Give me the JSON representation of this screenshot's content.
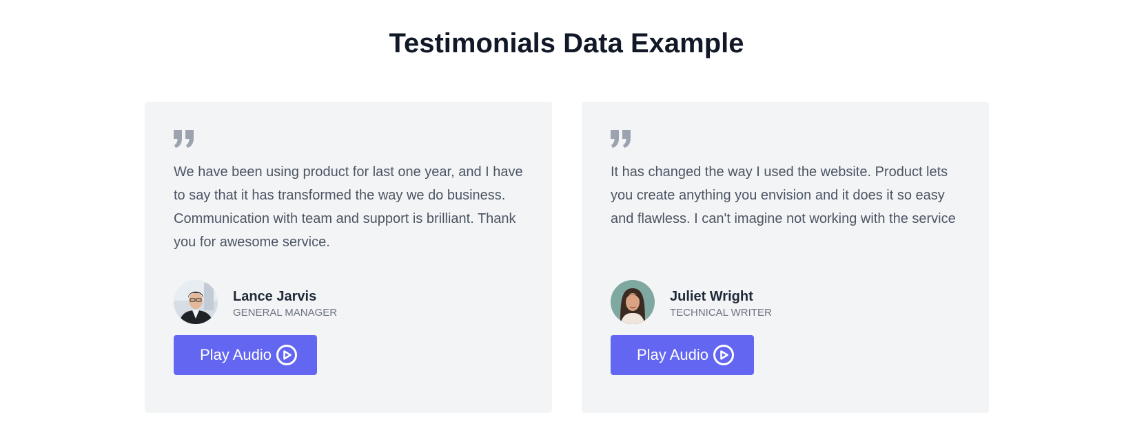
{
  "page": {
    "title": "Testimonials Data Example"
  },
  "testimonials": [
    {
      "text": "We have been using product for last one year, and I have to say that it has transformed the way we do business. Communication with team and support is brilliant. Thank you for awesome service.",
      "name": "Lance Jarvis",
      "role": "General Manager",
      "button_label": "Play Audio",
      "avatar_icon": "avatar-photo-man"
    },
    {
      "text": "It has changed the way I used the website. Product lets you create anything you envision and it does it so easy and flawless. I can't imagine not working with the service",
      "name": "Juliet Wright",
      "role": "Technical Writer",
      "button_label": "Play Audio",
      "avatar_icon": "avatar-photo-woman"
    }
  ],
  "colors": {
    "accent": "#6366f1",
    "card_background": "#f3f4f6",
    "quote_icon": "#9ca3af"
  }
}
